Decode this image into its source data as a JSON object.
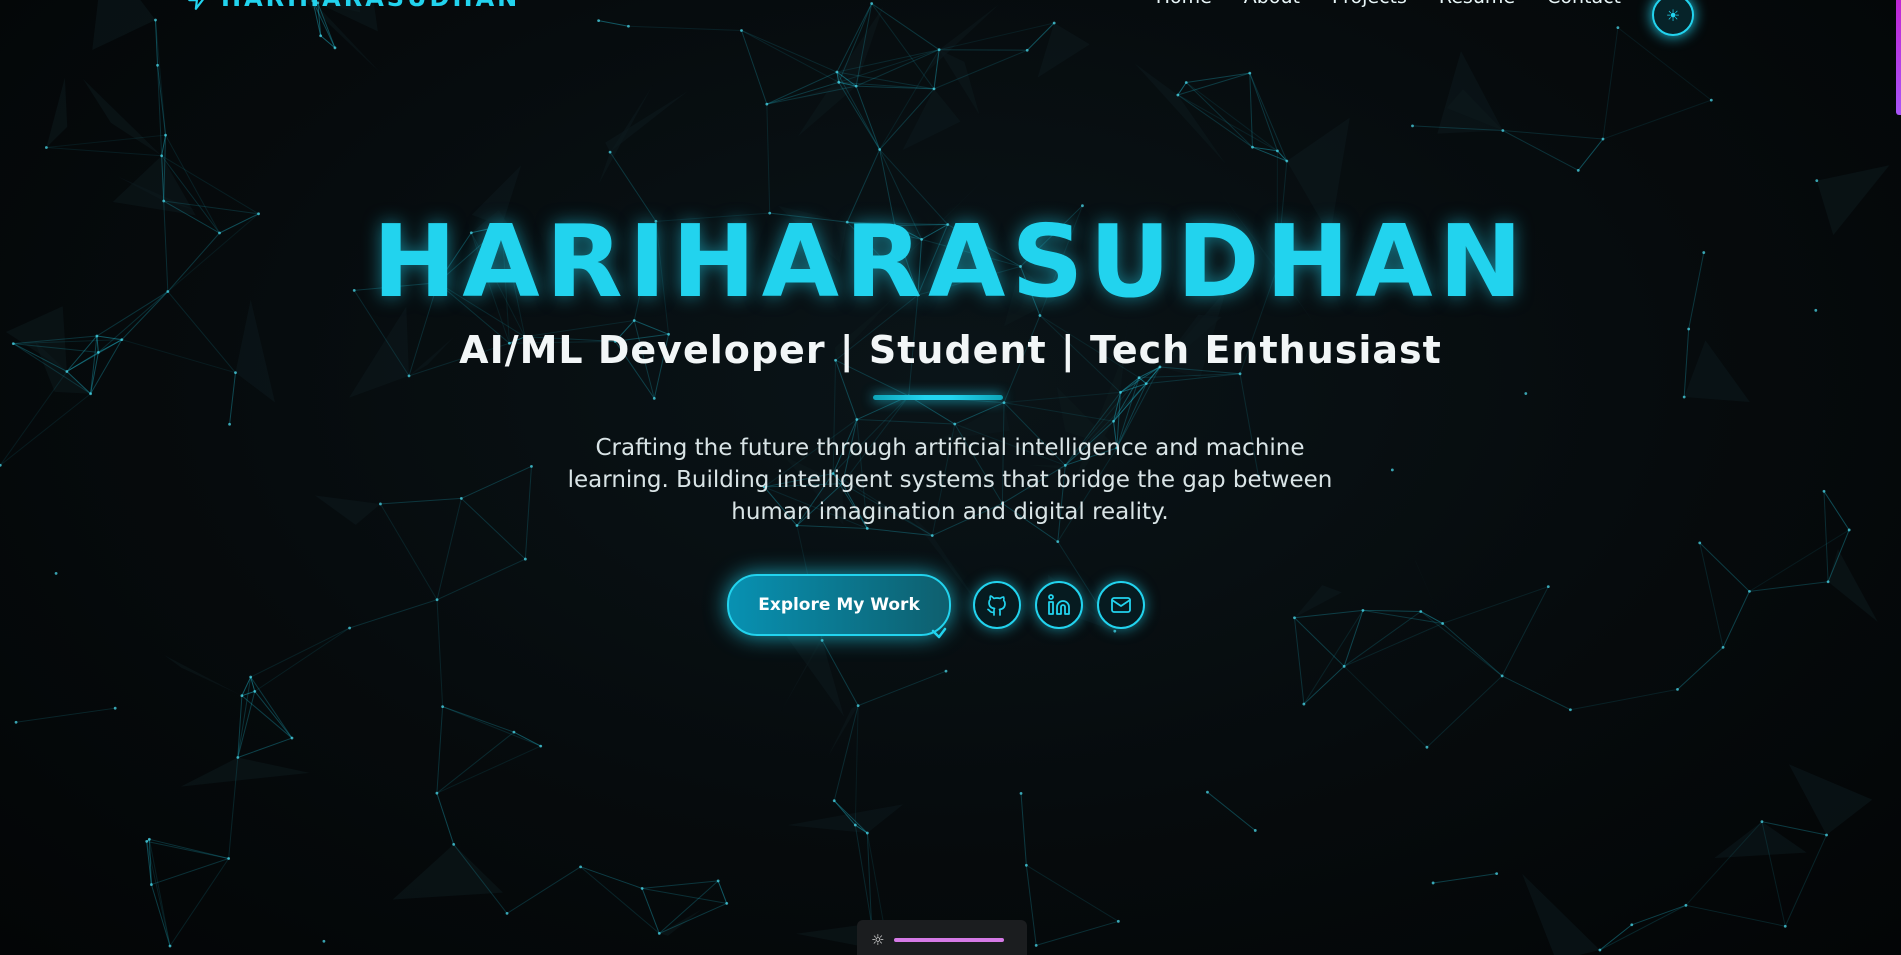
{
  "nav": {
    "brand": "HARIHARASUDHAN",
    "links": [
      {
        "label": "Home"
      },
      {
        "label": "About"
      },
      {
        "label": "Projects"
      },
      {
        "label": "Resume"
      },
      {
        "label": "Contact"
      }
    ],
    "theme_toggle_icon": "sun-icon"
  },
  "hero": {
    "title": "HARIHARASUDHAN",
    "subtitle": "AI/ML Developer | Student | Tech Enthusiast",
    "description": "Crafting the future through artificial intelligence and machine learning. Building intelligent systems that bridge the gap between human imagination and digital reality.",
    "cta_label": "Explore My Work",
    "social": [
      {
        "icon": "github-icon"
      },
      {
        "icon": "linkedin-icon"
      },
      {
        "icon": "mail-icon"
      }
    ]
  },
  "bottom_toolbar": {
    "icon": "sun-icon"
  },
  "colors": {
    "accent": "#22d3ee",
    "background": "#050809",
    "text": "#f2f6f7",
    "scroll_indicator": "#c026d3",
    "toolbar_slider": "#d57ae6"
  }
}
